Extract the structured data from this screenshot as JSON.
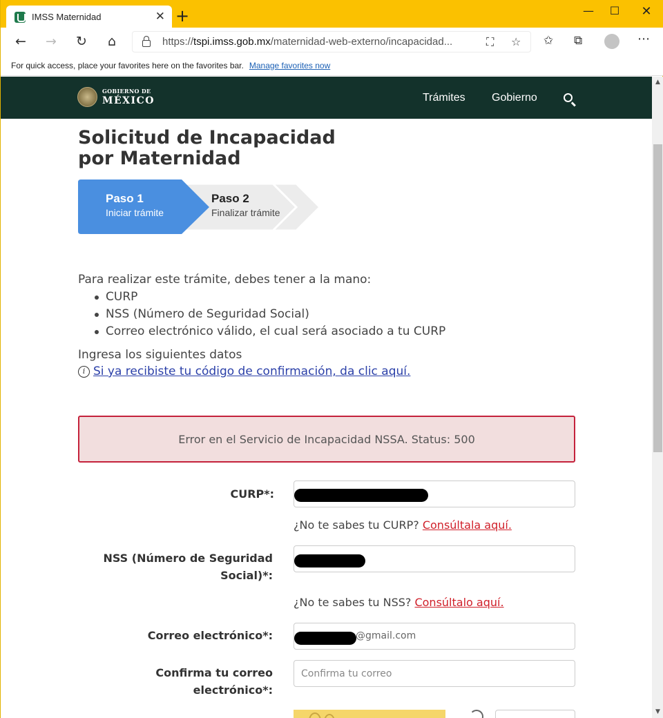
{
  "browser": {
    "tab_title": "IMSS Maternidad",
    "tab_close": "✕",
    "new_tab": "+",
    "url_prefix": "https://",
    "url_host": "tspi.imss.gob.mx",
    "url_path": "/maternidad-web-externo/incapacidad...",
    "favbar_text": "For quick access, place your favorites here on the favorites bar.",
    "favbar_link": "Manage favorites now",
    "icons": [
      "back-icon",
      "forward-icon",
      "reload-icon",
      "home-icon",
      "lock-icon",
      "read-aloud-icon",
      "star-icon",
      "favorites-icon",
      "collections-icon",
      "profile-icon",
      "more-icon"
    ]
  },
  "header": {
    "logo_small": "GOBIERNO DE",
    "logo_big": "MÉXICO",
    "nav": [
      "Trámites",
      "Gobierno"
    ]
  },
  "page": {
    "title_line1": "Solicitud de Incapacidad",
    "title_line2": "por Maternidad",
    "steps": [
      {
        "title": "Paso 1",
        "subtitle": "Iniciar trámite",
        "active": true
      },
      {
        "title": "Paso 2",
        "subtitle": "Finalizar trámite",
        "active": false
      }
    ],
    "intro": "Para realizar este trámite, debes tener a la mano:",
    "requirements": [
      "CURP",
      "NSS (Número de Seguridad Social)",
      "Correo electrónico válido, el cual será asociado a tu CURP"
    ],
    "prompt": "Ingresa los siguientes datos",
    "confirm_link": "Si ya recibiste tu código de confirmación, da clic aquí.",
    "error": "Error en el Servicio de Incapacidad NSSA. Status: 500"
  },
  "form": {
    "curp_label": "CURP*:",
    "curp_help": "¿No te sabes tu CURP?",
    "curp_help_link": "Consúltala aquí.",
    "nss_label_1": "NSS (Número de Seguridad",
    "nss_label_2": "Social)*:",
    "nss_help": "¿No te sabes tu NSS?",
    "nss_help_link": "Consúltalo aquí.",
    "email_label": "Correo electrónico*:",
    "email_suffix": "@gmail.com",
    "confirm_email_label_1": "Confirma tu correo",
    "confirm_email_label_2": "electrónico*:",
    "confirm_email_placeholder": "Confirma tu correo"
  },
  "colors": {
    "browser_accent": "#fbc100",
    "gov_header": "#13322b",
    "step_active": "#4a8fe0",
    "step_inactive": "#ececec",
    "error_bg": "#f2dede",
    "error_border": "#c4213b",
    "link": "#2a3fa8",
    "help_link": "#d0202a"
  }
}
